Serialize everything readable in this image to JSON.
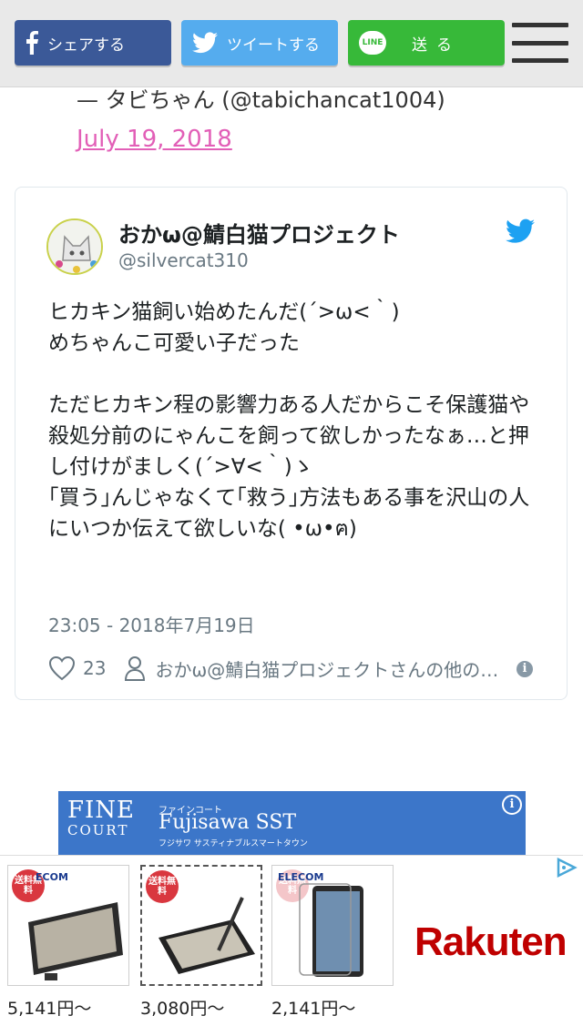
{
  "share_bar": {
    "facebook_label": "シェアする",
    "twitter_label": "ツイートする",
    "line_label": "送る",
    "line_icon_text": "LINE",
    "colors": {
      "facebook": "#3b5998",
      "twitter": "#55acee",
      "line": "#37b939"
    }
  },
  "previous_embed": {
    "author": "— タビちゃん (@tabichancat1004)",
    "date": "July 19, 2018"
  },
  "tweet": {
    "display_name": "おかω@鯖白猫プロジェクト",
    "handle": "@silvercat310",
    "body": "ヒカキン猫飼い始めたんだ(´>ω<｀)\nめちゃんこ可愛い子だった\n\nただヒカキン程の影響力ある人だからこそ保護猫や殺処分前のにゃんこを飼って欲しかったなぁ…と押し付けがましく(´>∀<｀)ゝ\n｢買う｣んじゃなくて｢救う｣方法もある事を沢山の人にいつか伝えて欲しいな( •ω•ฅ)",
    "timestamp": "23:05 - 2018年7月19日",
    "like_count": "23",
    "author_link": "おかω@鯖白猫プロジェクトさんの他のツイートを見る",
    "info_icon": "i"
  },
  "banner_ad": {
    "logo_line1": "FINE",
    "logo_line2": "COURT",
    "kana_top": "ファインコート",
    "name": "Fujisawa SST",
    "kana_bottom": "フジサワ サスティナブルスマートタウン",
    "info_icon": "i"
  },
  "product_ads": {
    "items": [
      {
        "badge": "送料無料",
        "brand": "ECOM",
        "price": "5,141円〜"
      },
      {
        "badge": "送料無料",
        "brand": "",
        "price": "3,080円〜"
      },
      {
        "badge": "送料無料",
        "brand": "ELECOM",
        "price": "2,141円〜"
      }
    ],
    "advertiser": "Rakuten"
  }
}
